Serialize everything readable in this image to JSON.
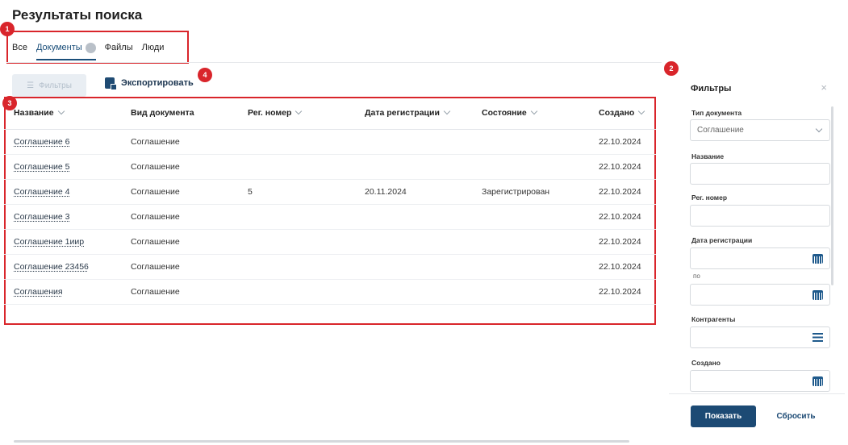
{
  "page": {
    "title": "Результаты поиска"
  },
  "markers": [
    "1",
    "2",
    "3",
    "4"
  ],
  "tabs": [
    {
      "label": "Все"
    },
    {
      "label": "Документы"
    },
    {
      "label": "Файлы"
    },
    {
      "label": "Люди"
    }
  ],
  "toolbar": {
    "filters_label": "Фильтры",
    "export_label": "Экспортировать"
  },
  "table": {
    "columns": [
      "Название",
      "Вид документа",
      "Рег. номер",
      "Дата регистрации",
      "Состояние",
      "Создано"
    ],
    "rows": [
      [
        "Соглашение 6",
        "Соглашение",
        "",
        "",
        "",
        "22.10.2024"
      ],
      [
        "Соглашение 5",
        "Соглашение",
        "",
        "",
        "",
        "22.10.2024"
      ],
      [
        "Соглашение 4",
        "Соглашение",
        "5",
        "20.11.2024",
        "Зарегистрирован",
        "22.10.2024"
      ],
      [
        "Соглашение 3",
        "Соглашение",
        "",
        "",
        "",
        "22.10.2024"
      ],
      [
        "Соглашение 1иир",
        "Соглашение",
        "",
        "",
        "",
        "22.10.2024"
      ],
      [
        "Соглашение 23456",
        "Соглашение",
        "",
        "",
        "",
        "22.10.2024"
      ],
      [
        "Соглашения",
        "Соглашение",
        "",
        "",
        "",
        "22.10.2024"
      ]
    ]
  },
  "filters": {
    "title": "Фильтры",
    "close": "×",
    "doc_type_label": "Тип документа",
    "doc_type_value": "Соглашение",
    "name_label": "Название",
    "reg_number_label": "Рег. номер",
    "reg_date_label": "Дата регистрации",
    "reg_date_to": "по",
    "contractors_label": "Контрагенты",
    "created_label": "Создано",
    "show_button": "Показать",
    "reset_button": "Сбросить"
  },
  "colors": {
    "accent": "#1c4a74",
    "callout": "#d9252b"
  }
}
